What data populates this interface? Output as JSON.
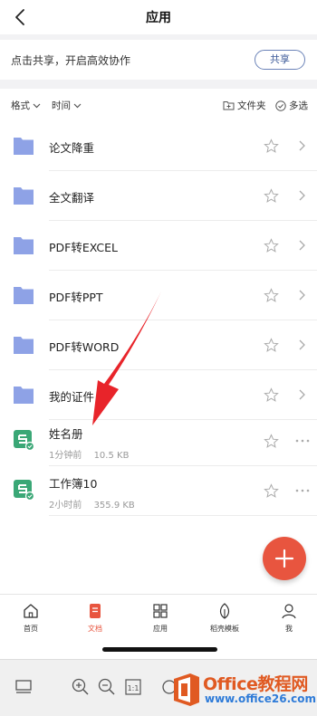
{
  "nav": {
    "title": "应用",
    "back_icon": "chevron-left-icon"
  },
  "share": {
    "text": "点击共享，开启高效协作",
    "button_label": "共享"
  },
  "toolbar": {
    "format_label": "格式",
    "time_label": "时间",
    "folder_label": "文件夹",
    "multi_select_label": "多选"
  },
  "folders": [
    {
      "name": "论文降重"
    },
    {
      "name": "全文翻译"
    },
    {
      "name": "PDF转EXCEL"
    },
    {
      "name": "PDF转PPT"
    },
    {
      "name": "PDF转WORD"
    },
    {
      "name": "我的证件"
    }
  ],
  "files": [
    {
      "name": "姓名册",
      "time": "1分钟前",
      "size": "10.5 KB"
    },
    {
      "name": "工作簿10",
      "time": "2小时前",
      "size": "355.9 KB"
    }
  ],
  "bottom_nav": [
    {
      "label": "首页",
      "icon": "home-icon"
    },
    {
      "label": "文档",
      "icon": "document-icon",
      "active": true
    },
    {
      "label": "应用",
      "icon": "apps-grid-icon"
    },
    {
      "label": "稻壳模板",
      "icon": "leaf-icon"
    },
    {
      "label": "我",
      "icon": "person-icon"
    }
  ],
  "watermark": {
    "brand": "Office教程网",
    "url": "www.office26.com"
  },
  "colors": {
    "accent": "#e8553f",
    "folder": "#8ea2e6",
    "sheet_icon": "#3aa776",
    "share_border": "#6b83b8",
    "annotation_arrow": "#e8242a"
  }
}
